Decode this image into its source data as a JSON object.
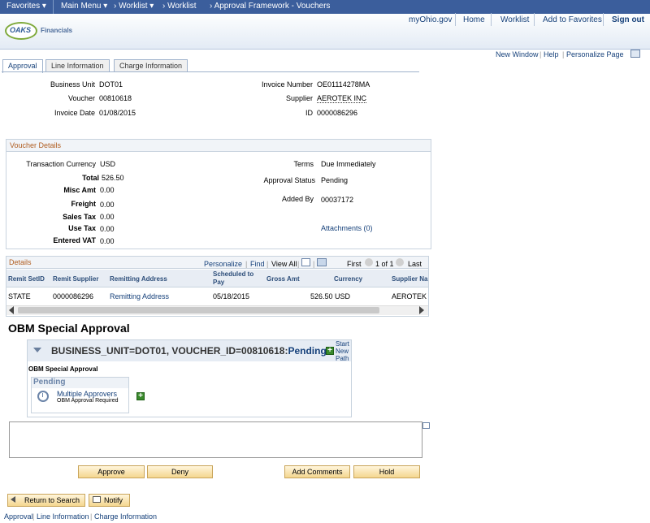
{
  "topnav": {
    "favorites": "Favorites",
    "main_menu": "Main Menu",
    "worklist1": "Worklist",
    "worklist2": "Worklist",
    "approval_framework": "Approval Framework - Vouchers"
  },
  "header": {
    "logo": "OAKS",
    "logo_sub": "Financials",
    "links": [
      "myOhio.gov",
      "Home",
      "Worklist",
      "Add to Favorites",
      "Sign out"
    ]
  },
  "utility": {
    "new_window": "New Window",
    "help": "Help",
    "personalize": "Personalize Page"
  },
  "tabs": [
    "Approval",
    "Line Information",
    "Charge Information"
  ],
  "summary": {
    "business_unit_label": "Business Unit",
    "business_unit": "DOT01",
    "voucher_label": "Voucher",
    "voucher": "00810618",
    "invoice_date_label": "Invoice Date",
    "invoice_date": "01/08/2015",
    "invoice_number_label": "Invoice Number",
    "invoice_number": "OE01114278MA",
    "supplier_label": "Supplier",
    "supplier": "AEROTEK INC",
    "id_label": "ID",
    "id": "0000086296"
  },
  "voucher_details": {
    "title": "Voucher Details",
    "transaction_currency_label": "Transaction Currency",
    "transaction_currency": "USD",
    "total_label": "Total",
    "total": "526.50",
    "misc_amt_label": "Misc Amt",
    "misc_amt": "0.00",
    "freight_label": "Freight",
    "freight": "0.00",
    "sales_tax_label": "Sales Tax",
    "sales_tax": "0.00",
    "use_tax_label": "Use Tax",
    "use_tax": "0.00",
    "entered_vat_label": "Entered VAT",
    "entered_vat": "0.00",
    "terms_label": "Terms",
    "terms": "Due Immediately",
    "approval_status_label": "Approval Status",
    "approval_status": "Pending",
    "added_by_label": "Added By",
    "added_by": "00037172",
    "attachments": "Attachments (0)"
  },
  "details": {
    "title": "Details",
    "personalize": "Personalize",
    "find": "Find",
    "view_all": "View All",
    "first": "First",
    "page": "1 of 1",
    "last": "Last",
    "columns": [
      "Remit SetID",
      "Remit Supplier",
      "Remitting Address",
      "Scheduled to Pay",
      "Gross Amt",
      "Currency",
      "Supplier Name"
    ],
    "row": [
      "STATE",
      "0000086296",
      "Remitting Address",
      "05/18/2015",
      "526.50",
      "USD",
      "AEROTEK IN"
    ]
  },
  "obm": {
    "title": "OBM Special Approval",
    "path_title": "BUSINESS_UNIT=DOT01, VOUCHER_ID=00810618:",
    "path_status": "Pending",
    "start_new_path": [
      "Start",
      "New",
      "Path"
    ],
    "stage": "OBM Special Approval",
    "status": "Pending",
    "approvers": "Multiple Approvers",
    "approvers_sub": "OBM Approval Required"
  },
  "buttons": {
    "approve": "Approve",
    "deny": "Deny",
    "add_comments": "Add Comments",
    "hold": "Hold",
    "return_to_search": "Return to Search",
    "notify": "Notify"
  },
  "footer_links": [
    "Approval",
    "Line Information",
    "Charge Information"
  ]
}
